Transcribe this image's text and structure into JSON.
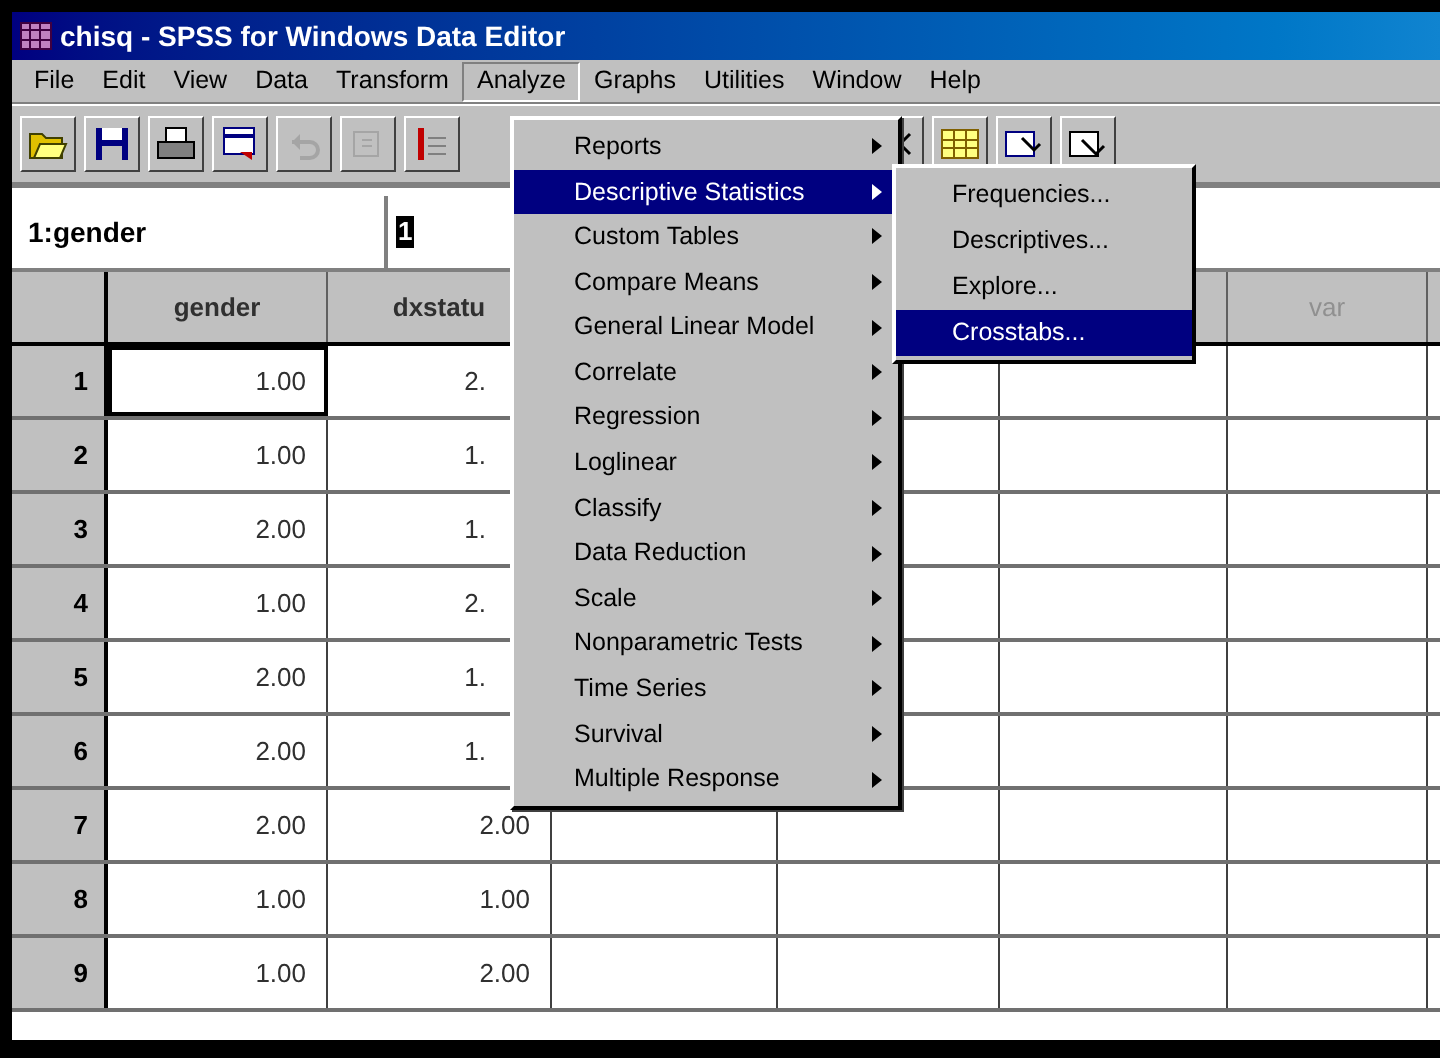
{
  "window": {
    "title": "chisq - SPSS for Windows Data Editor"
  },
  "menubar": [
    {
      "label": "File",
      "selected": false
    },
    {
      "label": "Edit",
      "selected": false
    },
    {
      "label": "View",
      "selected": false
    },
    {
      "label": "Data",
      "selected": false
    },
    {
      "label": "Transform",
      "selected": false
    },
    {
      "label": "Analyze",
      "selected": true
    },
    {
      "label": "Graphs",
      "selected": false
    },
    {
      "label": "Utilities",
      "selected": false
    },
    {
      "label": "Window",
      "selected": false
    },
    {
      "label": "Help",
      "selected": false
    }
  ],
  "toolbar": [
    {
      "kind": "open",
      "disabled": false
    },
    {
      "kind": "save",
      "disabled": false
    },
    {
      "kind": "print",
      "disabled": false
    },
    {
      "kind": "dialog",
      "disabled": false
    },
    {
      "kind": "undo",
      "disabled": true
    },
    {
      "kind": "redo",
      "disabled": true
    },
    {
      "kind": "goto",
      "disabled": false
    }
  ],
  "toolbar_right": [
    {
      "kind": "cursor",
      "disabled": false
    },
    {
      "kind": "grid",
      "disabled": false
    },
    {
      "kind": "labels",
      "disabled": false
    },
    {
      "kind": "sets",
      "disabled": false
    }
  ],
  "cell_editor": {
    "cell": "1:gender",
    "value": "1"
  },
  "columns": [
    {
      "kind": "variable",
      "label": "gender"
    },
    {
      "kind": "variable",
      "label": "dxstatu"
    },
    {
      "kind": "covered"
    },
    {
      "kind": "covered"
    },
    {
      "kind": "covered"
    },
    {
      "kind": "variable",
      "label": "var"
    }
  ],
  "rows": [
    {
      "number": "1",
      "cells": [
        {
          "text": "1.00",
          "selected": true
        },
        {
          "text": "2.",
          "selected": false
        }
      ]
    },
    {
      "number": "2",
      "cells": [
        {
          "text": "1.00",
          "selected": false
        },
        {
          "text": "1.",
          "selected": false
        }
      ]
    },
    {
      "number": "3",
      "cells": [
        {
          "text": "2.00",
          "selected": false
        },
        {
          "text": "1.",
          "selected": false
        }
      ]
    },
    {
      "number": "4",
      "cells": [
        {
          "text": "1.00",
          "selected": false
        },
        {
          "text": "2.",
          "selected": false
        }
      ]
    },
    {
      "number": "5",
      "cells": [
        {
          "text": "2.00",
          "selected": false
        },
        {
          "text": "1.",
          "selected": false
        }
      ]
    },
    {
      "number": "6",
      "cells": [
        {
          "text": "2.00",
          "selected": false
        },
        {
          "text": "1.",
          "selected": false
        }
      ]
    },
    {
      "number": "7",
      "cells": [
        {
          "text": "2.00",
          "selected": false
        },
        {
          "text": "2.00",
          "selected": false
        }
      ]
    },
    {
      "number": "8",
      "cells": [
        {
          "text": "1.00",
          "selected": false
        },
        {
          "text": "1.00",
          "selected": false
        }
      ]
    },
    {
      "number": "9",
      "cells": [
        {
          "text": "1.00",
          "selected": false
        },
        {
          "text": "2.00",
          "selected": false
        }
      ]
    }
  ],
  "analyze_menu": [
    {
      "label": "Reports",
      "selected": false,
      "has_submenu": true
    },
    {
      "label": "Descriptive Statistics",
      "selected": true,
      "has_submenu": true
    },
    {
      "label": "Custom Tables",
      "selected": false,
      "has_submenu": true
    },
    {
      "label": "Compare Means",
      "selected": false,
      "has_submenu": true
    },
    {
      "label": "General Linear Model",
      "selected": false,
      "has_submenu": true
    },
    {
      "label": "Correlate",
      "selected": false,
      "has_submenu": true
    },
    {
      "label": "Regression",
      "selected": false,
      "has_submenu": true
    },
    {
      "label": "Loglinear",
      "selected": false,
      "has_submenu": true
    },
    {
      "label": "Classify",
      "selected": false,
      "has_submenu": true
    },
    {
      "label": "Data Reduction",
      "selected": false,
      "has_submenu": true
    },
    {
      "label": "Scale",
      "selected": false,
      "has_submenu": true
    },
    {
      "label": "Nonparametric Tests",
      "selected": false,
      "has_submenu": true
    },
    {
      "label": "Time Series",
      "selected": false,
      "has_submenu": true
    },
    {
      "label": "Survival",
      "selected": false,
      "has_submenu": true
    },
    {
      "label": "Multiple Response",
      "selected": false,
      "has_submenu": true
    }
  ],
  "descriptive_submenu": [
    {
      "label": "Frequencies...",
      "selected": false
    },
    {
      "label": "Descriptives...",
      "selected": false
    },
    {
      "label": "Explore...",
      "selected": false
    },
    {
      "label": "Crosstabs...",
      "selected": true
    }
  ]
}
